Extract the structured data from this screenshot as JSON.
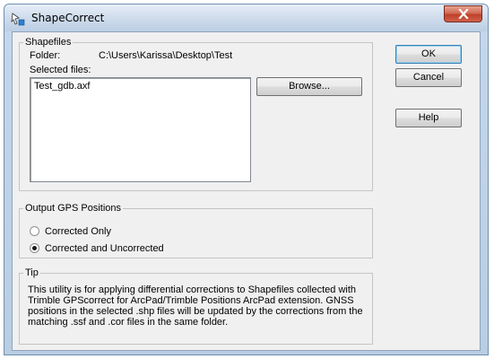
{
  "window": {
    "title": "ShapeCorrect",
    "close_icon": "close-x-icon",
    "app_icon": "shapecorrect-app-icon"
  },
  "shapefiles": {
    "legend": "Shapefiles",
    "folder_label": "Folder:",
    "folder_value": "C:\\Users\\Karissa\\Desktop\\Test",
    "selected_label": "Selected files:",
    "files": [
      "Test_gdb.axf"
    ],
    "browse_label": "Browse..."
  },
  "buttons": {
    "ok": "OK",
    "cancel": "Cancel",
    "help": "Help"
  },
  "output": {
    "legend": "Output GPS Positions",
    "options": [
      {
        "label": "Corrected Only",
        "selected": false
      },
      {
        "label": "Corrected and Uncorrected",
        "selected": true
      }
    ]
  },
  "tip": {
    "legend": "Tip",
    "text": "This utility is for applying differential corrections to Shapefiles collected with Trimble GPScorrect for ArcPad/Trimble Positions ArcPad extension. GNSS positions in the selected .shp files will be updated by the corrections from the matching .ssf and .cor files in the same folder."
  }
}
